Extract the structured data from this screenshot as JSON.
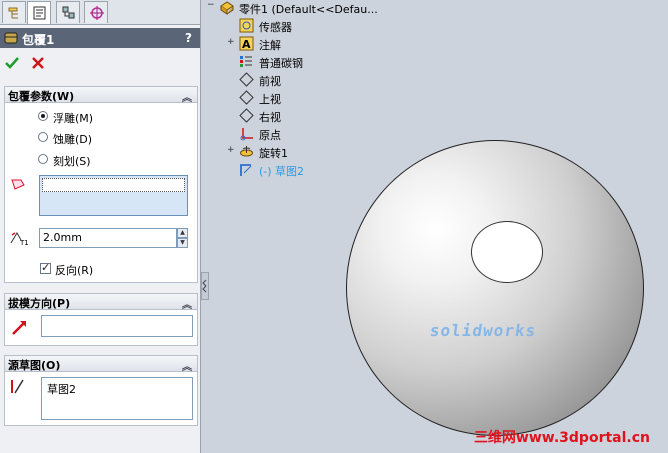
{
  "property_manager": {
    "title": "包覆1",
    "help_label": "?",
    "wrap_params": {
      "header": "包覆参数(W)",
      "options": [
        {
          "label": "浮雕(M)",
          "checked": true
        },
        {
          "label": "蚀雕(D)",
          "checked": false
        },
        {
          "label": "刻划(S)",
          "checked": false
        }
      ],
      "thickness": "2.0mm",
      "reverse_label": "反向(R)",
      "reverse_checked": true
    },
    "draft_direction": {
      "header": "拔模方向(P)",
      "value": ""
    },
    "source_sketch": {
      "header": "源草图(O)",
      "item": "草图2"
    }
  },
  "feature_tree": {
    "root": "零件1  (Default<<Defau...",
    "items": [
      {
        "label": "传感器",
        "icon": "sensor-icon"
      },
      {
        "label": "注解",
        "icon": "annotation-icon",
        "expandable": true
      },
      {
        "label": "普通碳钢",
        "icon": "material-icon"
      },
      {
        "label": "前视",
        "icon": "plane-icon"
      },
      {
        "label": "上视",
        "icon": "plane-icon"
      },
      {
        "label": "右视",
        "icon": "plane-icon"
      },
      {
        "label": "原点",
        "icon": "origin-icon"
      },
      {
        "label": "旋转1",
        "icon": "revolve-icon",
        "expandable": true
      },
      {
        "label": "(-) 草图2",
        "icon": "sketch-icon",
        "highlight": true
      }
    ]
  },
  "viewport": {
    "emboss_text": "solidworks",
    "watermark": "三维网www.3dportal.cn"
  },
  "colors": {
    "title_bar": "#5a6578",
    "accent_blue": "#2b6fd0",
    "watermark_red": "#e0121b"
  }
}
